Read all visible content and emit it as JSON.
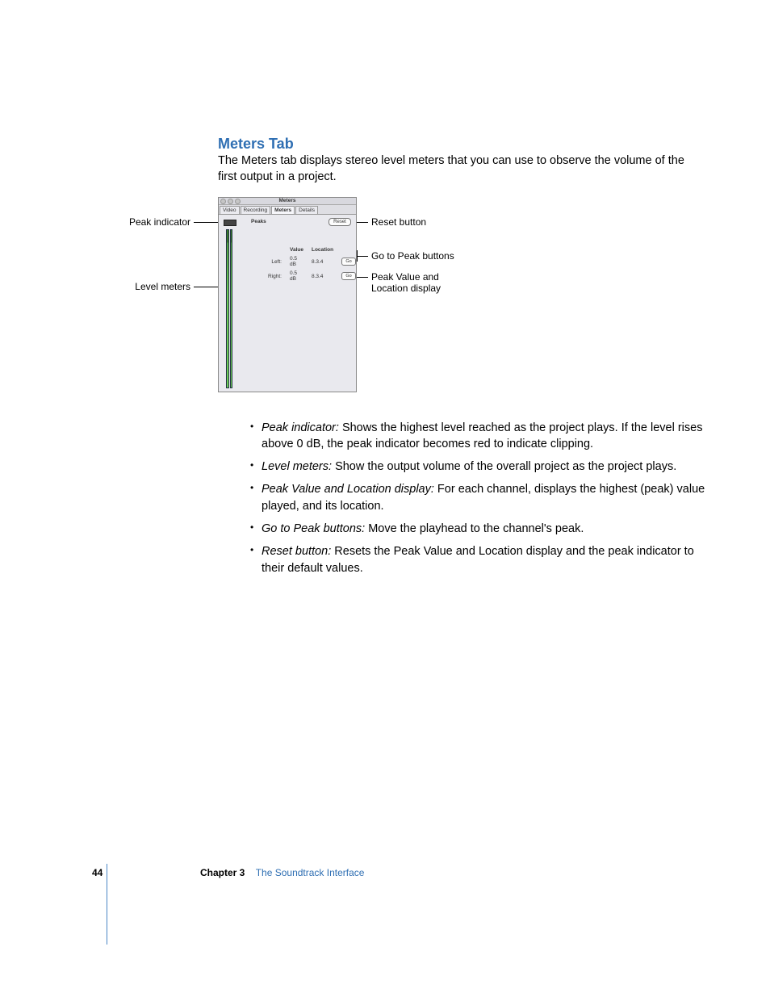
{
  "heading": "Meters Tab",
  "intro": "The Meters tab displays stereo level meters that you can use to observe the volume of the first output in a project.",
  "callouts": {
    "peak_indicator": "Peak indicator",
    "level_meters": "Level meters",
    "reset_button": "Reset button",
    "go_to_peak": "Go to Peak buttons",
    "peak_value_loc_1": "Peak Value and",
    "peak_value_loc_2": "Location display"
  },
  "mini": {
    "window_title": "Meters",
    "tabs": [
      "Video",
      "Recording",
      "Meters",
      "Details"
    ],
    "active_tab": "Meters",
    "peaks_label": "Peaks",
    "reset_label": "Reset",
    "value_hdr": "Value",
    "location_hdr": "Location",
    "rows": [
      {
        "label": "Left:",
        "value": "0.5 dB",
        "location": "8.3.4",
        "go": "Go"
      },
      {
        "label": "Right:",
        "value": "0.5 dB",
        "location": "8.3.4",
        "go": "Go"
      }
    ]
  },
  "bullets": [
    {
      "term": "Peak indicator:",
      "text": "  Shows the highest level reached as the project plays. If the level rises above 0 dB, the peak indicator becomes red to indicate clipping."
    },
    {
      "term": "Level meters:",
      "text": "  Show the output volume of the overall project as the project plays."
    },
    {
      "term": "Peak Value and Location display:",
      "text": "  For each channel, displays the highest (peak) value played, and its location."
    },
    {
      "term": "Go to Peak buttons:",
      "text": "  Move the playhead to the channel's peak."
    },
    {
      "term": "Reset button:",
      "text": "  Resets the Peak Value and Location display and the peak indicator to their default values."
    }
  ],
  "footer": {
    "page": "44",
    "chapter_label": "Chapter 3",
    "chapter_title": "The Soundtrack Interface"
  }
}
